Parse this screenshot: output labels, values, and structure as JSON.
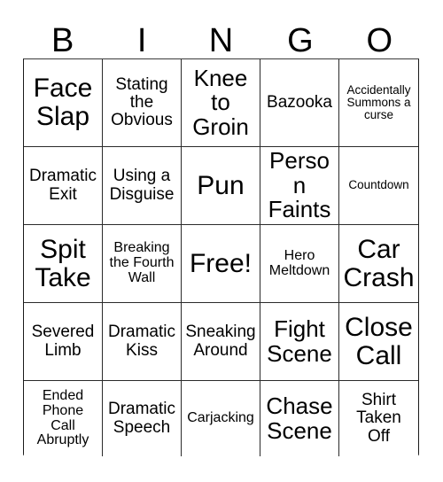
{
  "card": {
    "header_letters": [
      "B",
      "I",
      "N",
      "G",
      "O"
    ],
    "columns": 5,
    "rows": 5,
    "free_space_label": "Free!",
    "background_color": "#ffffff",
    "text_color": "#000000",
    "border_color": "#2b2b2b",
    "cells": [
      {
        "text": "Face\nSlap",
        "size": "fs-xl"
      },
      {
        "text": "Stating\nthe\nObvious",
        "size": "fs-md"
      },
      {
        "text": "Knee\nto\nGroin",
        "size": "fs-lg"
      },
      {
        "text": "Bazooka",
        "size": "fs-md"
      },
      {
        "text": "Accidentally\nSummons a\ncurse",
        "size": "fs-xs"
      },
      {
        "text": "Dramatic\nExit",
        "size": "fs-md"
      },
      {
        "text": "Using a\nDisguise",
        "size": "fs-md"
      },
      {
        "text": "Pun",
        "size": "fs-xl"
      },
      {
        "text": "Person\nFaints",
        "size": "fs-lg"
      },
      {
        "text": "Countdown",
        "size": "fs-xs"
      },
      {
        "text": "Spit\nTake",
        "size": "fs-xl"
      },
      {
        "text": "Breaking\nthe Fourth\nWall",
        "size": "fs-sm"
      },
      {
        "text": "Free!",
        "size": "fs-xl"
      },
      {
        "text": "Hero\nMeltdown",
        "size": "fs-sm"
      },
      {
        "text": "Car\nCrash",
        "size": "fs-xl"
      },
      {
        "text": "Severed\nLimb",
        "size": "fs-md"
      },
      {
        "text": "Dramatic\nKiss",
        "size": "fs-md"
      },
      {
        "text": "Sneaking\nAround",
        "size": "fs-md"
      },
      {
        "text": "Fight\nScene",
        "size": "fs-lg"
      },
      {
        "text": "Close\nCall",
        "size": "fs-xl"
      },
      {
        "text": "Ended\nPhone\nCall\nAbruptly",
        "size": "fs-sm"
      },
      {
        "text": "Dramatic\nSpeech",
        "size": "fs-md"
      },
      {
        "text": "Carjacking",
        "size": "fs-sm"
      },
      {
        "text": "Chase\nScene",
        "size": "fs-lg"
      },
      {
        "text": "Shirt\nTaken\nOff",
        "size": "fs-md"
      }
    ]
  }
}
